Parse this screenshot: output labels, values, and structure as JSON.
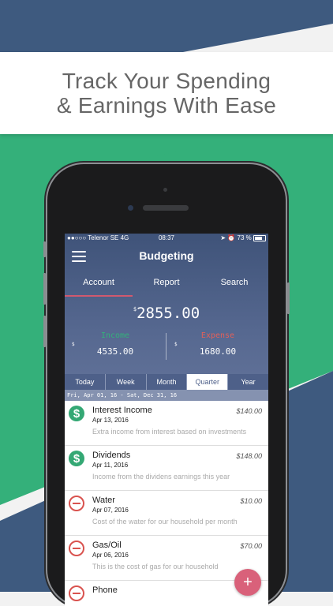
{
  "banner": {
    "line1": "Track Your Spending",
    "line2": "& Earnings With Ease"
  },
  "colors": {
    "stripe_blue": "#3e5a7f",
    "stripe_green": "#34b07a",
    "income_green": "#34a874",
    "expense_red": "#d9534f",
    "accent_pink": "#d0596f"
  },
  "status": {
    "carrier": "●●○○○ Telenor SE  4G",
    "time": "08:37",
    "battery": "73 %"
  },
  "app": {
    "title": "Budgeting",
    "menu_icon": "hamburger-icon"
  },
  "tabs": [
    {
      "label": "Account",
      "active": true
    },
    {
      "label": "Report"
    },
    {
      "label": "Search"
    }
  ],
  "balance": {
    "currency": "$",
    "amount": "2855.00"
  },
  "income": {
    "label": "Income",
    "currency": "$",
    "value": "4535.00"
  },
  "expense": {
    "label": "Expense",
    "currency": "$",
    "value": "1680.00"
  },
  "periods": [
    "Today",
    "Week",
    "Month",
    "Quarter",
    "Year"
  ],
  "selected_period": "Quarter",
  "date_range": "Fri, Apr 01, 16 - Sat, Dec 31, 16",
  "transactions": [
    {
      "name": "Interest Income",
      "date": "Apr 13, 2016",
      "amount": "$140.00",
      "desc": "Extra income from interest based on investments",
      "type": "income",
      "icon": "dollar-icon"
    },
    {
      "name": "Dividends",
      "date": "Apr 11, 2016",
      "amount": "$148.00",
      "desc": "Income from the dividens earnings this year",
      "type": "income",
      "icon": "dollar-icon"
    },
    {
      "name": "Water",
      "date": "Apr 07, 2016",
      "amount": "$10.00",
      "desc": "Cost of the water for our household per month",
      "type": "expense",
      "icon": "minus-circle-icon"
    },
    {
      "name": "Gas/Oil",
      "date": "Apr 06, 2016",
      "amount": "$70.00",
      "desc": "This is the cost of gas for our household",
      "type": "expense",
      "icon": "minus-circle-icon"
    },
    {
      "name": "Phone",
      "date": "",
      "amount": "",
      "desc": "",
      "type": "expense",
      "icon": "minus-circle-icon"
    }
  ],
  "fab": {
    "label": "+",
    "icon": "plus-icon"
  }
}
